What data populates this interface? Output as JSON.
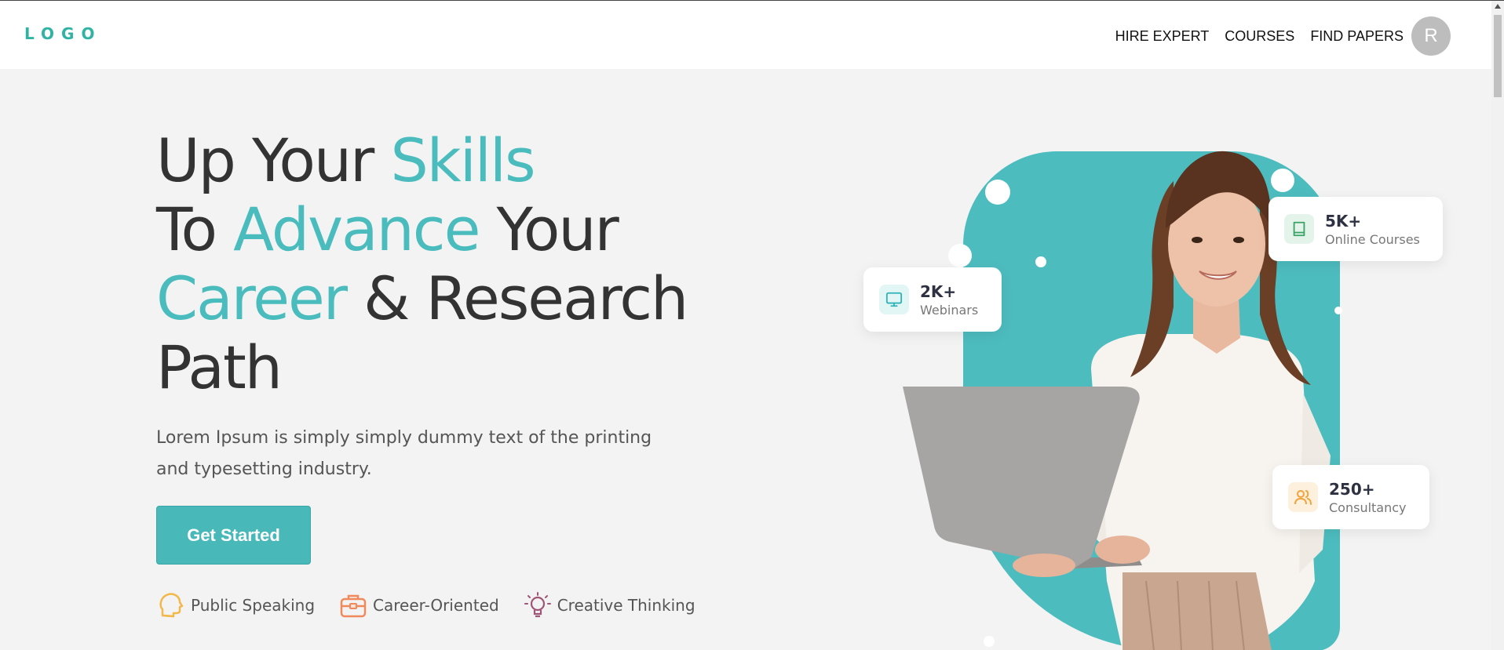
{
  "nav": {
    "logo": "LOGO",
    "links": [
      "HIRE EXPERT",
      "COURSES",
      "FIND PAPERS"
    ],
    "avatar_initial": "R"
  },
  "hero": {
    "line1_a": "Up Your ",
    "line1_b": "Skills",
    "line2_a": "To ",
    "line2_b": "Advance",
    "line2_c": " Your",
    "line3_a": "Career",
    "line3_b": " & Research",
    "line4": "Path",
    "description": "Lorem Ipsum is simply simply dummy text of the printing and typesetting industry.",
    "cta_label": "Get Started"
  },
  "skills": [
    {
      "label": "Public Speaking",
      "icon": "head-speaking-icon"
    },
    {
      "label": "Career-Oriented",
      "icon": "briefcase-icon"
    },
    {
      "label": "Creative Thinking",
      "icon": "lightbulb-icon"
    }
  ],
  "stats": [
    {
      "value": "2K+",
      "label": "Webinars",
      "icon": "monitor-icon"
    },
    {
      "value": "5K+",
      "label": "Online Courses",
      "icon": "book-icon"
    },
    {
      "value": "250+",
      "label": "Consultancy",
      "icon": "users-icon"
    }
  ],
  "colors": {
    "accent": "#4bbcbd",
    "brand_logo": "#2fb3a3",
    "cta": "#49b8b9",
    "text_dark": "#333333"
  }
}
